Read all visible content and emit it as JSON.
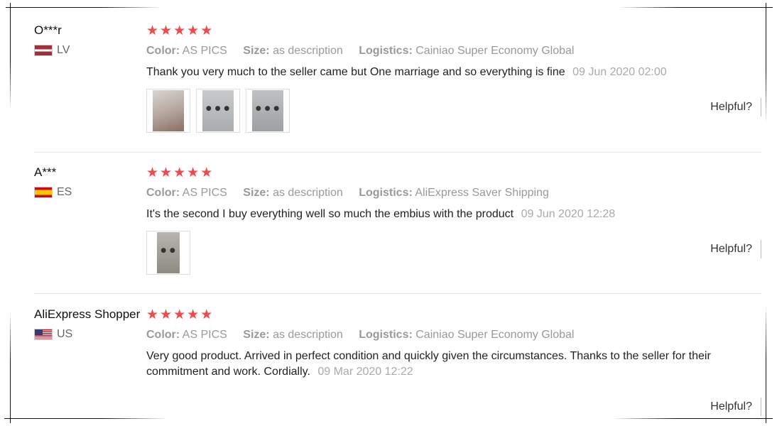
{
  "reviews": [
    {
      "user": "O***r",
      "country": "LV",
      "rating_stars": 5,
      "color_label": "Color:",
      "color_value": "AS PICS",
      "size_label": "Size:",
      "size_value": "as description",
      "logistics_label": "Logistics:",
      "logistics_value": "Cainiao Super Economy Global",
      "text": "Thank you very much to the seller came but One marriage and so everything is fine",
      "date": "09 Jun 2020 02:00",
      "photo_count": 3,
      "helpful_label": "Helpful?"
    },
    {
      "user": "A***",
      "country": "ES",
      "rating_stars": 5,
      "color_label": "Color:",
      "color_value": "AS PICS",
      "size_label": "Size:",
      "size_value": "as description",
      "logistics_label": "Logistics:",
      "logistics_value": "AliExpress Saver Shipping",
      "text": "It's the second I buy everything well so much the embius with the product",
      "date": "09 Jun 2020 12:28",
      "photo_count": 1,
      "helpful_label": "Helpful?"
    },
    {
      "user": "AliExpress Shopper",
      "country": "US",
      "rating_stars": 5,
      "color_label": "Color:",
      "color_value": "AS PICS",
      "size_label": "Size:",
      "size_value": "as description",
      "logistics_label": "Logistics:",
      "logistics_value": "Cainiao Super Economy Global",
      "text": "Very good product. Arrived in perfect condition and quickly given the circumstances. Thanks to the seller for their commitment and work. Cordially.",
      "date": "09 Mar 2020 12:22",
      "photo_count": 0,
      "helpful_label": "Helpful?"
    }
  ],
  "colors": {
    "star": "#f0484b",
    "muted_text": "#999999",
    "body_text": "#222222"
  }
}
